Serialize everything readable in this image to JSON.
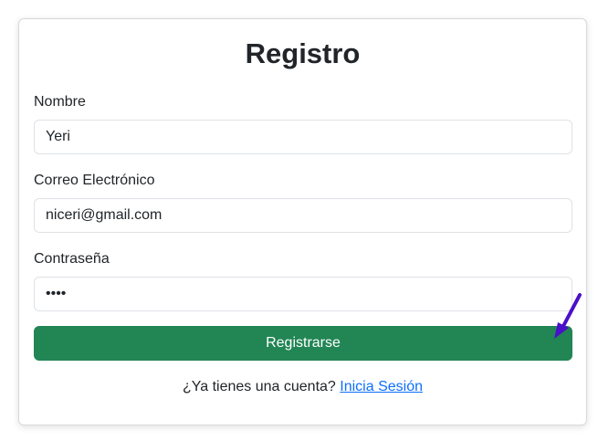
{
  "form": {
    "title": "Registro",
    "name_label": "Nombre",
    "name_value": "Yeri",
    "email_label": "Correo Electrónico",
    "email_value": "niceri@gmail.com",
    "password_label": "Contraseña",
    "password_value": "1234",
    "submit_label": "Registrarse",
    "login_prompt": "¿Ya tienes una cuenta?",
    "login_link": "Inicia Sesión"
  },
  "colors": {
    "submit_bg": "#218554",
    "link": "#0d6efd",
    "arrow": "#4a0fc9"
  },
  "icons": {
    "annotation": "arrow-pointer-icon"
  }
}
